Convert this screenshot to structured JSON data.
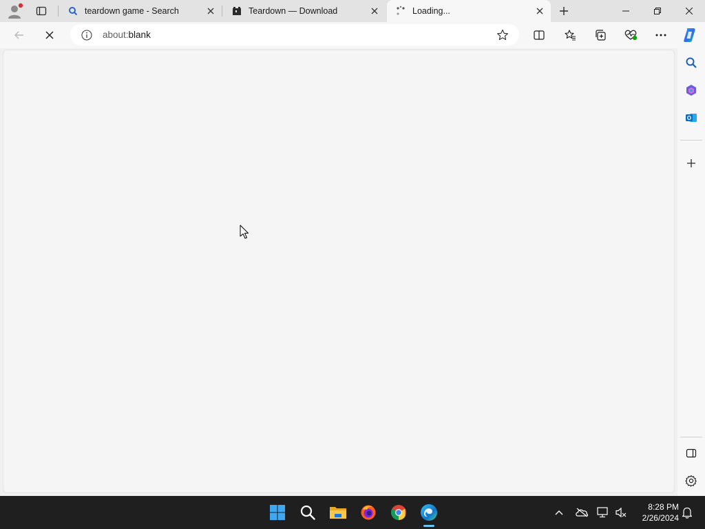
{
  "browser": {
    "tabs": [
      {
        "title": "teardown game - Search",
        "favicon": "search-icon"
      },
      {
        "title": "Teardown — Download",
        "favicon": "teardown-logo-icon"
      },
      {
        "title": "Loading...",
        "favicon": "loading-spinner-icon",
        "active": true
      }
    ],
    "address": {
      "scheme": "about:",
      "path": "blank"
    },
    "colors": {
      "accent": "#0078d4",
      "content_bg": "#f5f5f5",
      "taskbar_bg": "#1f1f1f"
    }
  },
  "taskbar": {
    "apps": [
      "windows-start-icon",
      "search-icon",
      "file-explorer-icon",
      "firefox-icon",
      "chrome-icon",
      "edge-icon"
    ],
    "clock": {
      "time": "8:28 PM",
      "date": "2/26/2024"
    }
  }
}
